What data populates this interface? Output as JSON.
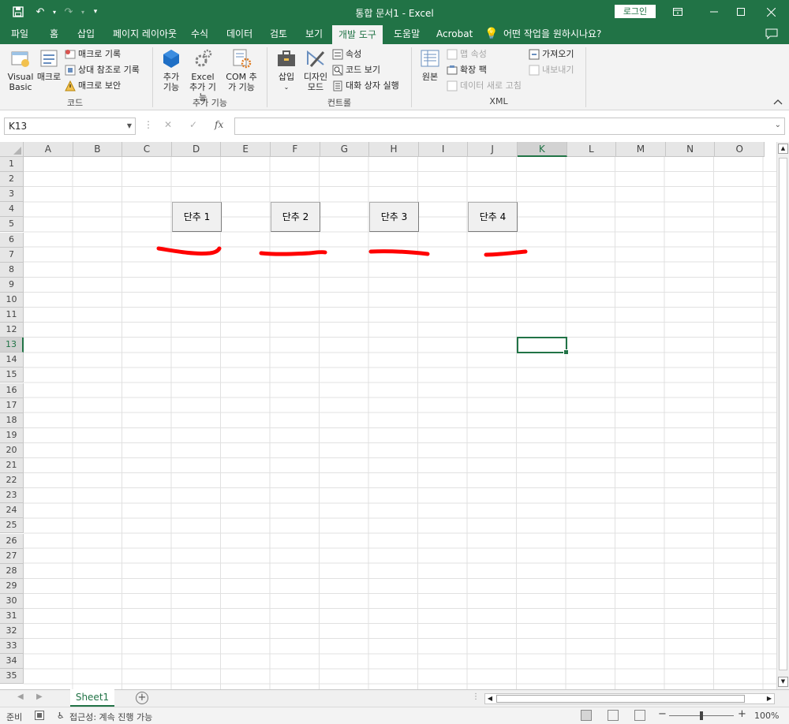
{
  "titlebar": {
    "title": "통합 문서1  -  Excel",
    "login": "로그인",
    "quick_more": "▾"
  },
  "tabs": [
    "파일",
    "홈",
    "삽입",
    "페이지 레이아웃",
    "수식",
    "데이터",
    "검토",
    "보기",
    "개발 도구",
    "도움말",
    "Acrobat",
    "어떤 작업을 원하시나요?"
  ],
  "ribbon": {
    "code": {
      "visual_basic": "Visual Basic",
      "macro": "매크로",
      "record_macro": "매크로 기록",
      "relative_ref": "상대 참조로 기록",
      "macro_security": "매크로 보안",
      "label": "코드"
    },
    "addins": {
      "addins": "추가 기능",
      "excel_addins": "Excel 추가 기능",
      "com_addins": "COM 추가 기능",
      "label": "추가 기능"
    },
    "controls": {
      "insert": "삽입",
      "design_mode": "디자인 모드",
      "properties": "속성",
      "view_code": "코드 보기",
      "run_dialog": "대화 상자 실행",
      "label": "컨트롤"
    },
    "xml": {
      "source": "원본",
      "map_properties": "맵 속성",
      "expansion_packs": "확장 팩",
      "refresh_data": "데이터 새로 고침",
      "import": "가져오기",
      "export": "내보내기",
      "label": "XML"
    }
  },
  "formula_bar": {
    "name_box": "K13",
    "cancel": "✕",
    "enter": "✓",
    "fx": "fx",
    "value": ""
  },
  "columns": [
    "A",
    "B",
    "C",
    "D",
    "E",
    "F",
    "G",
    "H",
    "I",
    "J",
    "K",
    "L",
    "M",
    "N",
    "O"
  ],
  "selected_column": "K",
  "rows": [
    "1",
    "2",
    "3",
    "4",
    "5",
    "6",
    "7",
    "8",
    "9",
    "10",
    "11",
    "12",
    "13",
    "14",
    "15",
    "16",
    "17",
    "18",
    "19",
    "20",
    "21",
    "22",
    "23",
    "24",
    "25",
    "26",
    "27",
    "28",
    "29",
    "30",
    "31",
    "32",
    "33",
    "34",
    "35"
  ],
  "selected_row": "13",
  "active_cell": "K13",
  "buttons": [
    "단추 1",
    "단추 2",
    "단추 3",
    "단추 4"
  ],
  "annotation_color": "#ff0000",
  "accent_color": "#217346",
  "sheets": [
    "Sheet1"
  ],
  "status": {
    "ready": "준비",
    "accessibility": "접근성: 계속 진행 가능",
    "zoom": "100%",
    "zoom_minus": "−",
    "zoom_plus": "+"
  }
}
